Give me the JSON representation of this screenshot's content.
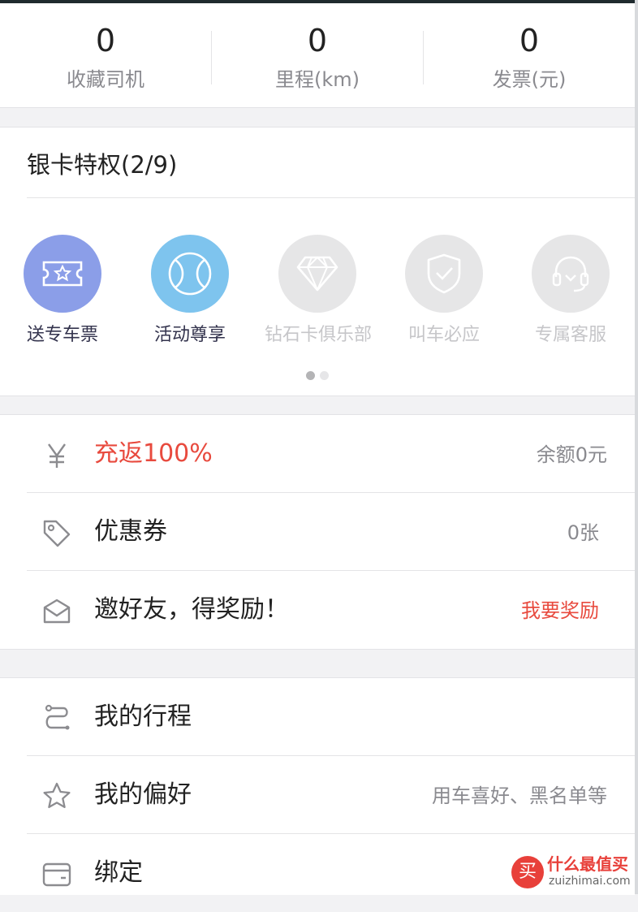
{
  "stats": [
    {
      "value": "0",
      "label": "收藏司机"
    },
    {
      "value": "0",
      "label": "里程(km)"
    },
    {
      "value": "0",
      "label": "发票(元)"
    }
  ],
  "privileges": {
    "title": "银卡特权(2/9)",
    "items": [
      {
        "label": "送专车票",
        "icon": "ticket-star-icon",
        "active": true,
        "color": "#8b9ee8"
      },
      {
        "label": "活动尊享",
        "icon": "tennis-ball-icon",
        "active": true,
        "color": "#7ec4ee"
      },
      {
        "label": "钻石卡俱乐部",
        "icon": "diamond-icon",
        "active": false,
        "color": "#e6e6e7"
      },
      {
        "label": "叫车必应",
        "icon": "shield-check-icon",
        "active": false,
        "color": "#e6e6e7"
      },
      {
        "label": "专属客服",
        "icon": "headset-icon",
        "active": false,
        "color": "#e6e6e7"
      }
    ],
    "page_count": 2,
    "current_page": 1
  },
  "wallet": {
    "items": [
      {
        "icon": "yen-icon",
        "label": "充返100%",
        "label_color": "#e84a3e",
        "right": "余额0元",
        "right_color": "#8a8a8f"
      },
      {
        "icon": "tag-icon",
        "label": "优惠券",
        "right": "0张",
        "right_color": "#8a8a8f"
      },
      {
        "icon": "envelope-icon",
        "label": "邀好友，得奖励！",
        "right": "我要奖励",
        "right_color": "#e84a3e"
      }
    ]
  },
  "menu": {
    "items": [
      {
        "icon": "route-icon",
        "label": "我的行程",
        "right": ""
      },
      {
        "icon": "star-icon",
        "label": "我的偏好",
        "right": "用车喜好、黑名单等"
      },
      {
        "icon": "card-icon",
        "label": "绑定",
        "right": ""
      }
    ]
  },
  "watermark": {
    "cn": "什么最值买",
    "en": "zuizhimai.com",
    "logo_char": "买"
  },
  "colors": {
    "accent_red": "#e84a3e",
    "icon_gray": "#8c8c90"
  }
}
